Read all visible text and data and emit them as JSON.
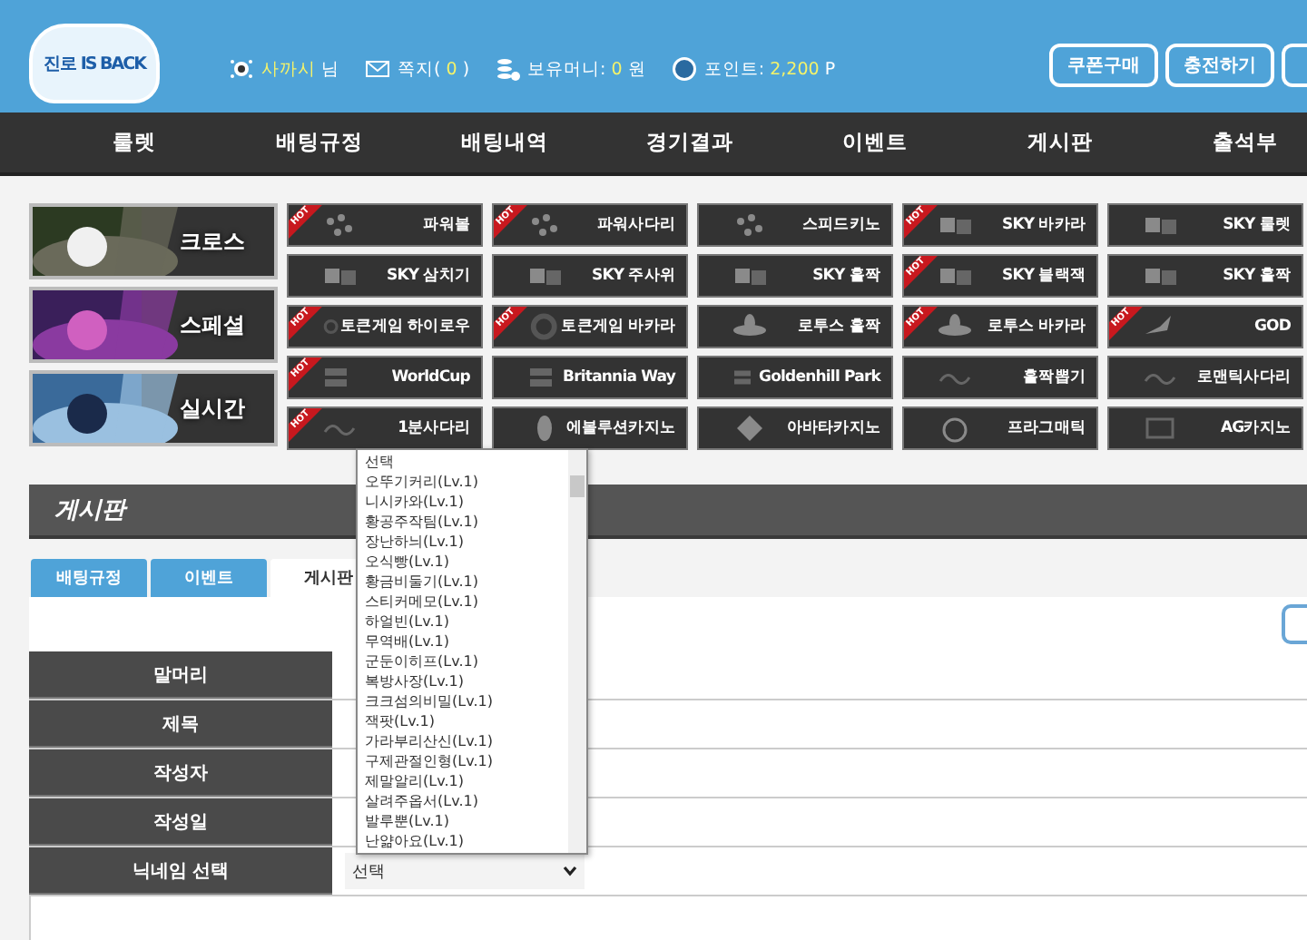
{
  "header": {
    "logo": "진로 IS BACK",
    "info": [
      {
        "kind": "level",
        "value": "사까시",
        "suffix": " 님"
      },
      {
        "kind": "mail",
        "prefix": "쪽지( ",
        "value": "0",
        "suffix": " )"
      },
      {
        "kind": "coins",
        "prefix": "보유머니: ",
        "value": "0",
        "suffix": " 원"
      },
      {
        "kind": "point",
        "prefix": "포인트: ",
        "value": "2,200",
        "suffix": " P"
      }
    ],
    "buttons": [
      "쿠폰구매",
      "충전하기"
    ]
  },
  "nav": [
    "룰렛",
    "배팅규정",
    "배팅내역",
    "경기결과",
    "이벤트",
    "게시판",
    "출석부"
  ],
  "banners": [
    {
      "label": "크로스",
      "kind": "soccer"
    },
    {
      "label": "스페셜",
      "kind": "purple"
    },
    {
      "label": "실시간",
      "kind": "ice"
    }
  ],
  "games": [
    {
      "label": "파워볼",
      "kind": "wave",
      "badge": "HOT"
    },
    {
      "label": "파워사다리",
      "kind": "wave",
      "badge": "HOT"
    },
    {
      "label": "스피드키노",
      "kind": "wave"
    },
    {
      "label": "SKY 바카라",
      "kind": "cube",
      "badge": "HOT"
    },
    {
      "label": "SKY 룰렛",
      "kind": "cube"
    },
    {
      "label": "SKY 삼치기",
      "kind": "cube"
    },
    {
      "label": "SKY 주사위",
      "kind": "cube"
    },
    {
      "label": "SKY 홀짝",
      "kind": "cube"
    },
    {
      "label": "SKY 블랙잭",
      "kind": "cube",
      "badge": "HOT"
    },
    {
      "label": "SKY 홀짝",
      "kind": "cube"
    },
    {
      "label": "토큰게임 하이로우",
      "kind": "ring",
      "badge": "HOT"
    },
    {
      "label": "토큰게임 바카라",
      "kind": "ring",
      "badge": "HOT"
    },
    {
      "label": "로투스 홀짝",
      "kind": "lotus"
    },
    {
      "label": "로투스 바카라",
      "kind": "lotus",
      "badge": "HOT"
    },
    {
      "label": "GOD",
      "kind": "bird",
      "badge": "HOT"
    },
    {
      "label": "WorldCup",
      "kind": "bet",
      "badge": "HOT"
    },
    {
      "label": "Britannia Way",
      "kind": "bet"
    },
    {
      "label": "Goldenhill Park",
      "kind": "bet"
    },
    {
      "label": "홀짝뽑기",
      "kind": "script"
    },
    {
      "label": "로맨틱사다리",
      "kind": "script"
    },
    {
      "label": "1분사다리",
      "kind": "script",
      "badge": "HOT"
    },
    {
      "label": "에볼루션카지노",
      "kind": "leaf"
    },
    {
      "label": "아바타카지노",
      "kind": "diamond"
    },
    {
      "label": "프라그매틱",
      "kind": "clock"
    },
    {
      "label": "AG카지노",
      "kind": "square"
    }
  ],
  "board": {
    "title": "게시판",
    "tabs": [
      {
        "label": "배팅규정",
        "selected": false
      },
      {
        "label": "이벤트",
        "selected": false
      },
      {
        "label": "게시판",
        "selected": true
      }
    ],
    "fields": [
      {
        "label": "말머리",
        "kind": "text"
      },
      {
        "label": "제목",
        "kind": "text"
      },
      {
        "label": "작성자",
        "kind": "text"
      },
      {
        "label": "작성일",
        "kind": "text"
      },
      {
        "label": "닉네임 선택",
        "kind": "select",
        "value": "선택"
      }
    ]
  },
  "dropdown": {
    "options": [
      "선택",
      "오뚜기커리(Lv.1)",
      "니시카와(Lv.1)",
      "황공주작팀(Lv.1)",
      "장난하늬(Lv.1)",
      "오식빵(Lv.1)",
      "황금비둘기(Lv.1)",
      "스티커메모(Lv.1)",
      "하얼빈(Lv.1)",
      "무역배(Lv.1)",
      "군둔이히프(Lv.1)",
      "복방사장(Lv.1)",
      "크크섬의비밀(Lv.1)",
      "잭팟(Lv.1)",
      "가라부리산신(Lv.1)",
      "구제관절인형(Lv.1)",
      "제말알리(Lv.1)",
      "살려주옵서(Lv.1)",
      "발루뿐(Lv.1)",
      "난얆아요(Lv.1)"
    ]
  }
}
